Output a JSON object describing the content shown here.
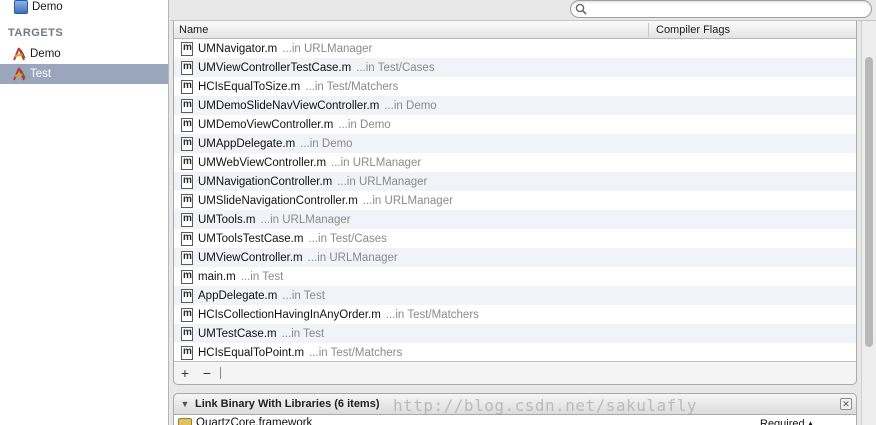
{
  "navigator": {
    "project_name": "Demo",
    "targets_header": "TARGETS",
    "targets": [
      {
        "label": "Demo"
      },
      {
        "label": "Test"
      }
    ]
  },
  "search": {
    "value": "",
    "placeholder": ""
  },
  "compile_sources": {
    "columns": {
      "name": "Name",
      "flags": "Compiler Flags"
    },
    "files": [
      {
        "name": "UMNavigator.m",
        "path": "...in URLManager"
      },
      {
        "name": "UMViewControllerTestCase.m",
        "path": "...in Test/Cases"
      },
      {
        "name": "HCIsEqualToSize.m",
        "path": "...in Test/Matchers"
      },
      {
        "name": "UMDemoSlideNavViewController.m",
        "path": "...in Demo"
      },
      {
        "name": "UMDemoViewController.m",
        "path": "...in Demo"
      },
      {
        "name": "UMAppDelegate.m",
        "path": "...in Demo"
      },
      {
        "name": "UMWebViewController.m",
        "path": "...in URLManager"
      },
      {
        "name": "UMNavigationController.m",
        "path": "...in URLManager"
      },
      {
        "name": "UMSlideNavigationController.m",
        "path": "...in URLManager"
      },
      {
        "name": "UMTools.m",
        "path": "...in URLManager"
      },
      {
        "name": "UMToolsTestCase.m",
        "path": "...in Test/Cases"
      },
      {
        "name": "UMViewController.m",
        "path": "...in URLManager"
      },
      {
        "name": "main.m",
        "path": "...in Test"
      },
      {
        "name": "AppDelegate.m",
        "path": "...in Test"
      },
      {
        "name": "HCIsCollectionHavingInAnyOrder.m",
        "path": "...in Test/Matchers"
      },
      {
        "name": "UMTestCase.m",
        "path": "...in Test"
      },
      {
        "name": "HCIsEqualToPoint.m",
        "path": "...in Test/Matchers"
      }
    ],
    "file_icon_glyph": "m",
    "add_label": "+",
    "remove_label": "−"
  },
  "link_phase": {
    "title": "Link Binary With Libraries (6 items)",
    "disclosure": "▼",
    "close": "✕",
    "first_library": {
      "name": "QuartzCore.framework",
      "status": "Required ▴"
    }
  },
  "watermark": "http://blog.csdn.net/sakulafly",
  "icons": {
    "project": "xcode-project-icon",
    "target": "target-app-icon",
    "search": "magnifier-icon",
    "file": "objc-source-file-icon",
    "library": "framework-icon"
  },
  "colors": {
    "selection": "#9aa6bb",
    "row_alt": "#f0f3f8",
    "path_text": "#8a8a8a"
  }
}
